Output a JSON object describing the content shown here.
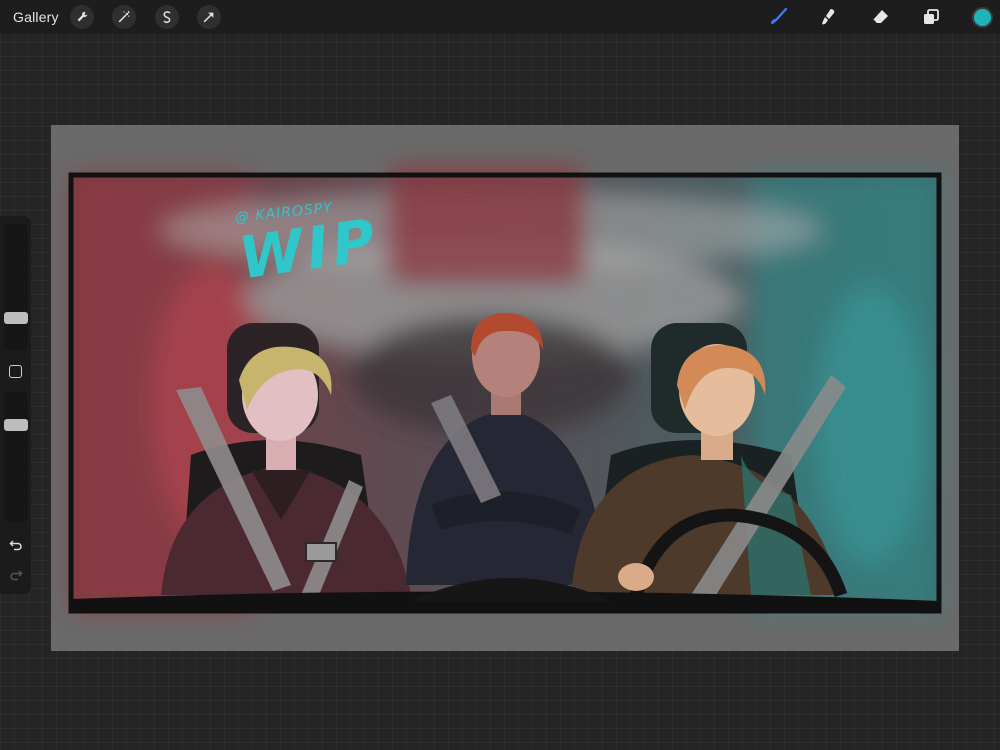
{
  "app": {
    "gallery_label": "Gallery"
  },
  "toolbar": {
    "left_icons": [
      "wrench-icon",
      "magic-wand-icon",
      "selection-icon",
      "transform-arrow-icon"
    ],
    "right_icons": [
      "brush-icon",
      "smudge-icon",
      "eraser-icon",
      "layers-icon"
    ],
    "active_tool": "brush",
    "current_color": "#1fb5b8"
  },
  "sidebar": {
    "brush_size_level": 0.23,
    "opacity_level": 0.77,
    "undo_icon": "undo-arrow-icon",
    "redo_icon": "redo-arrow-icon"
  },
  "artwork": {
    "handle": "@ KAIROSPY",
    "watermark": "WIP"
  },
  "colors": {
    "accent": "#1fb5b8",
    "brush_active": "#3f7bf5",
    "canvas_paper": "#6a6a6a"
  }
}
